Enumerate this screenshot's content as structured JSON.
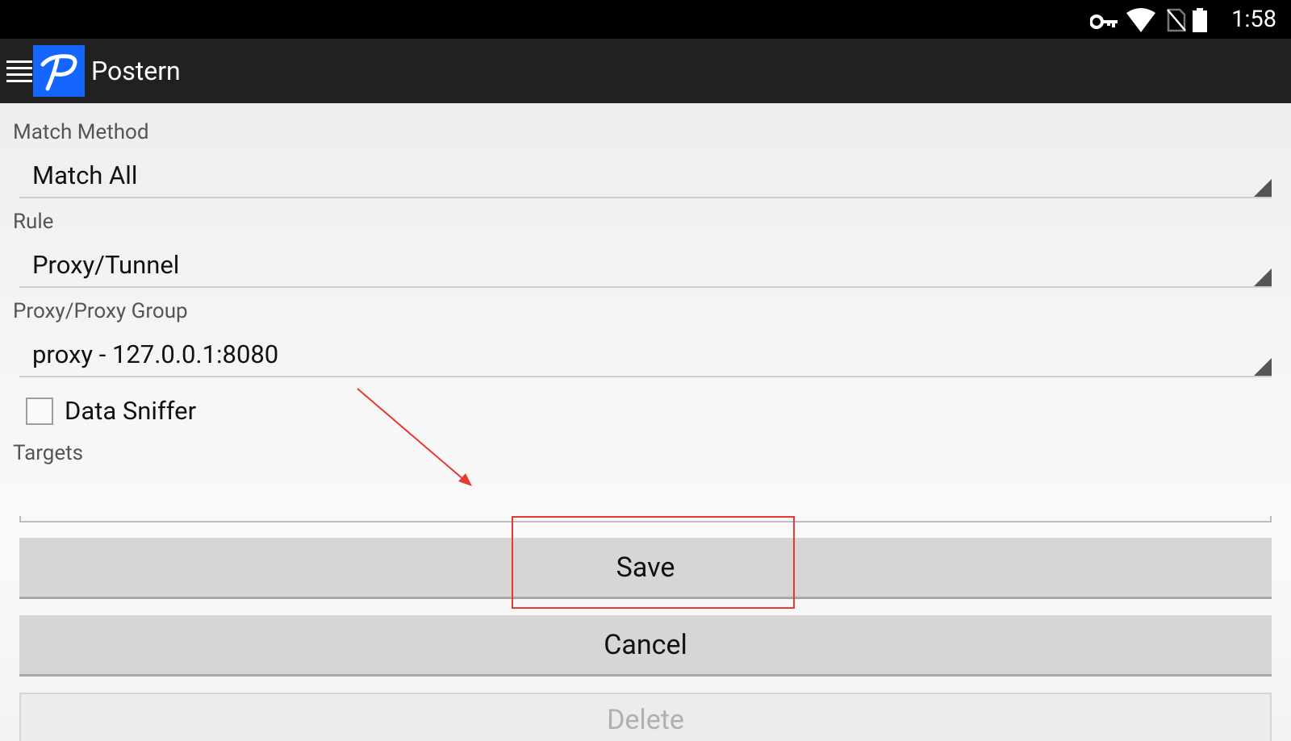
{
  "status_bar": {
    "time": "1:58",
    "icons": [
      "vpn-key-icon",
      "wifi-icon",
      "no-sim-icon",
      "battery-icon"
    ]
  },
  "app_bar": {
    "menu_icon": "hamburger-menu-icon",
    "logo_text": "P",
    "title": "Postern"
  },
  "form": {
    "match_method": {
      "label": "Match Method",
      "value": "Match All"
    },
    "rule": {
      "label": "Rule",
      "value": "Proxy/Tunnel"
    },
    "proxy_group": {
      "label": "Proxy/Proxy Group",
      "value": "proxy - 127.0.0.1:8080"
    },
    "data_sniffer": {
      "label": "Data Sniffer",
      "checked": false
    },
    "targets": {
      "label": "Targets",
      "value": ""
    }
  },
  "buttons": {
    "save": "Save",
    "cancel": "Cancel",
    "delete": "Delete"
  },
  "colors": {
    "status_bar": "#000000",
    "app_bar": "#212121",
    "logo_bg": "#1565ff",
    "annotation": "#e53935"
  }
}
